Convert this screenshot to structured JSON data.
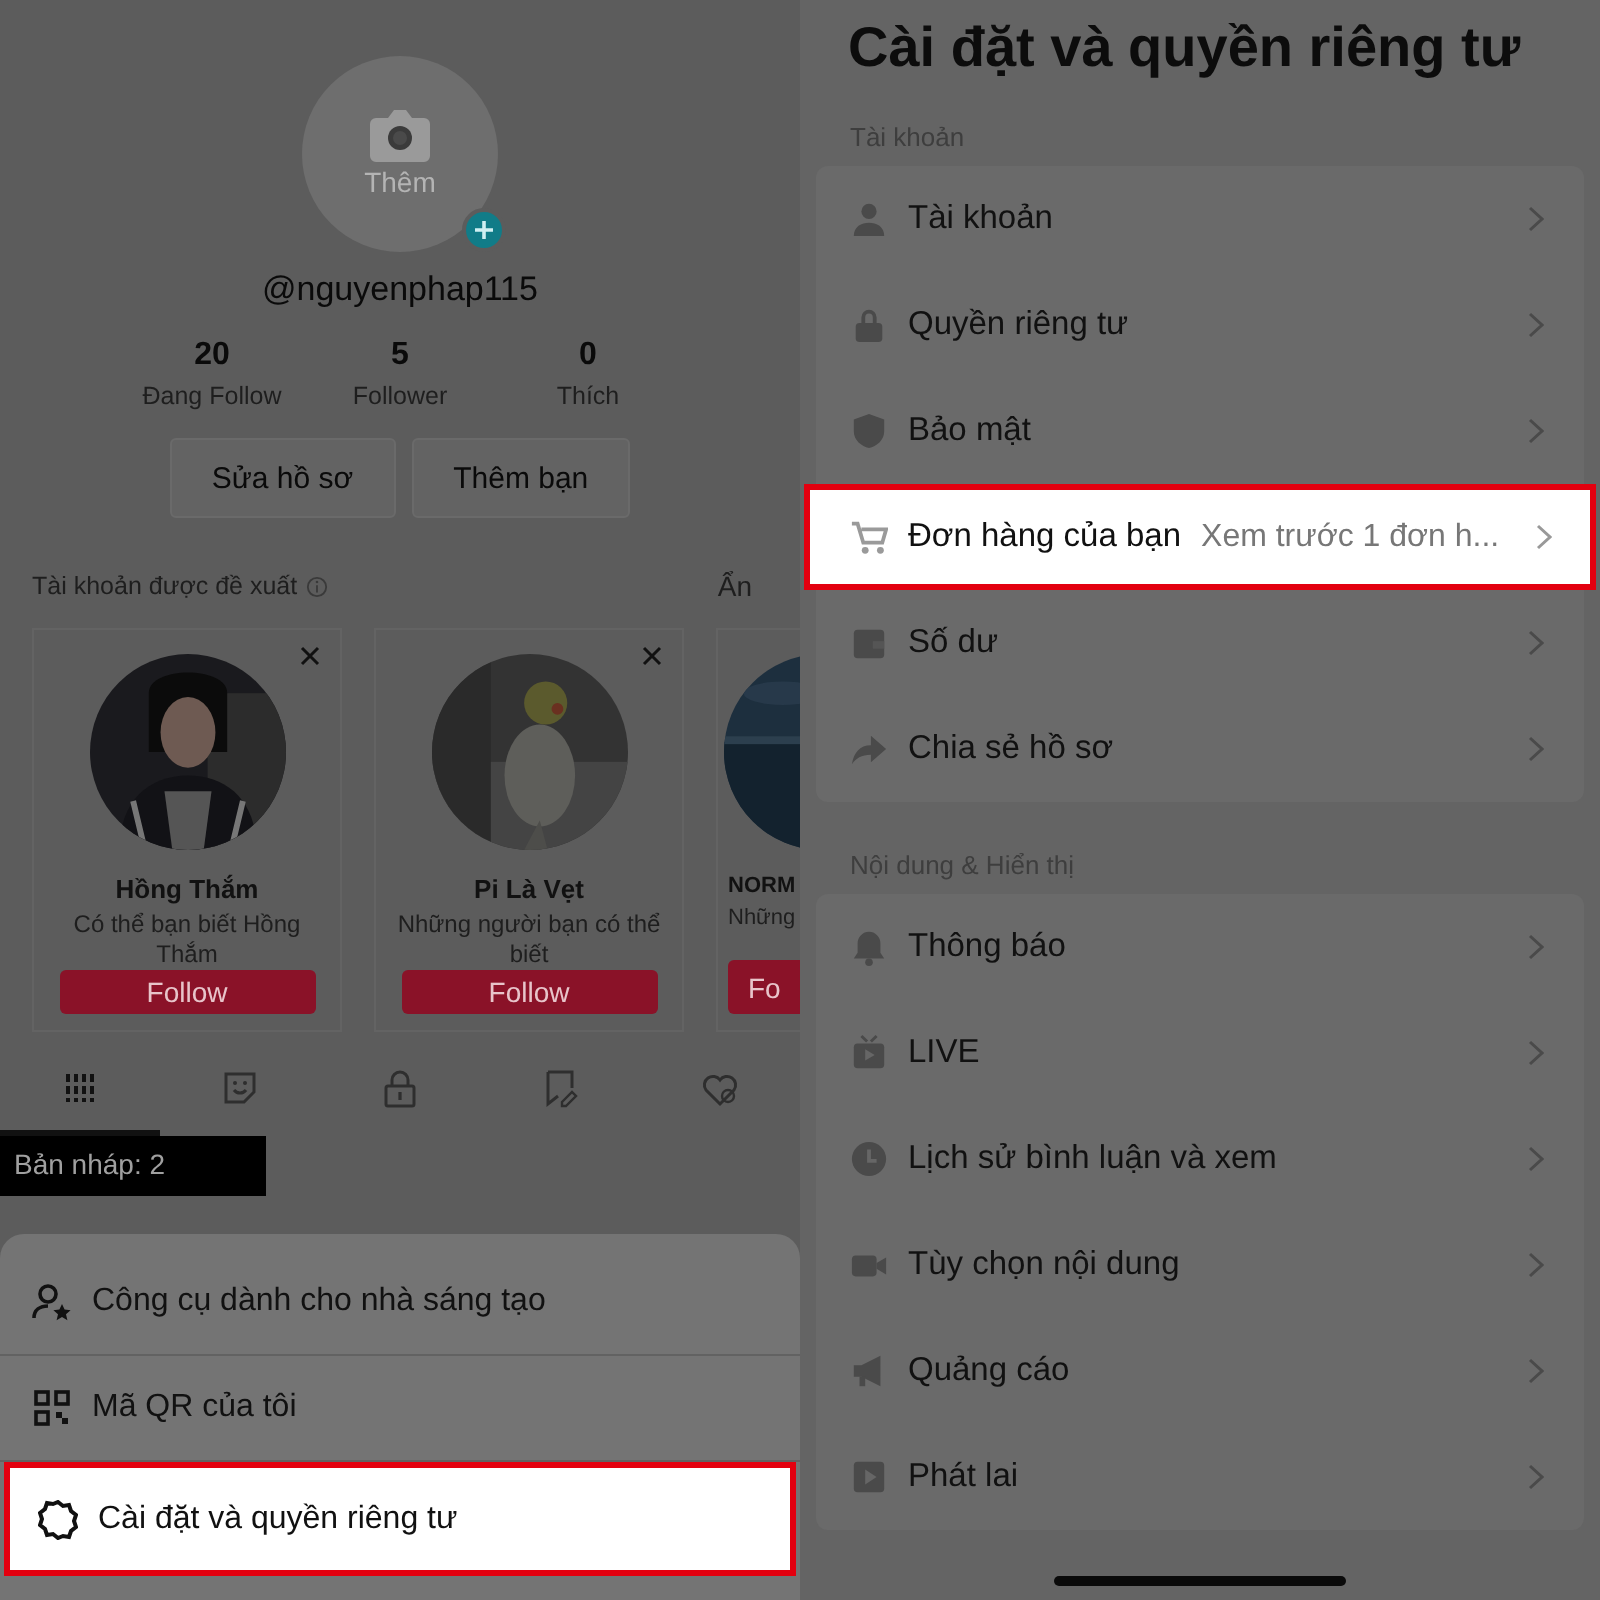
{
  "profile": {
    "avatar_label": "Thêm",
    "username": "@nguyenphap115",
    "stats": [
      {
        "value": "20",
        "label": "Đang Follow"
      },
      {
        "value": "5",
        "label": "Follower"
      },
      {
        "value": "0",
        "label": "Thích"
      }
    ],
    "buttons": [
      "Sửa hồ sơ",
      "Thêm bạn"
    ]
  },
  "suggested": {
    "title": "Tài khoản được đề xuất",
    "hide": "Ẩn",
    "cards": [
      {
        "name": "Hồng Thắm",
        "subtitle": "Có thể bạn biết Hồng Thắm",
        "follow": "Follow"
      },
      {
        "name": "Pi Là Vẹt",
        "subtitle": "Những người bạn có thể biết",
        "follow": "Follow"
      },
      {
        "name": "NORM",
        "subtitle": "Những",
        "follow": "Fo"
      }
    ]
  },
  "content_tabs": [
    {
      "selected": true
    },
    {
      "selected": false
    },
    {
      "selected": false
    },
    {
      "selected": false
    },
    {
      "selected": false
    }
  ],
  "drafts": "Bản nháp: 2",
  "menu_sheet": {
    "items": [
      {
        "label": "Công cụ dành cho nhà sáng tạo",
        "selected": false
      },
      {
        "label": "Mã QR của tôi",
        "selected": false
      },
      {
        "label": "Cài đặt và quyền riêng tư",
        "selected": true
      }
    ]
  },
  "settings": {
    "title": "Cài đặt và quyền riêng tư",
    "sections": [
      {
        "heading": "Tài khoản",
        "items": [
          {
            "label": "Tài khoản",
            "selected": false
          },
          {
            "label": "Quyền riêng tư",
            "selected": false
          },
          {
            "label": "Bảo mật",
            "selected": false
          },
          {
            "label": "Đơn hàng của bạn",
            "detail": "Xem trước 1 đơn h...",
            "selected": true
          },
          {
            "label": "Số dư",
            "selected": false
          },
          {
            "label": "Chia sẻ hồ sơ",
            "selected": false
          }
        ]
      },
      {
        "heading": "Nội dung & Hiển thị",
        "items": [
          {
            "label": "Thông báo",
            "selected": false
          },
          {
            "label": "LIVE",
            "selected": false
          },
          {
            "label": "Lịch sử bình luận và xem",
            "selected": false
          },
          {
            "label": "Tùy chọn nội dung",
            "selected": false
          },
          {
            "label": "Quảng cáo",
            "selected": false
          },
          {
            "label": "Phát lai",
            "selected": false
          }
        ]
      }
    ]
  }
}
